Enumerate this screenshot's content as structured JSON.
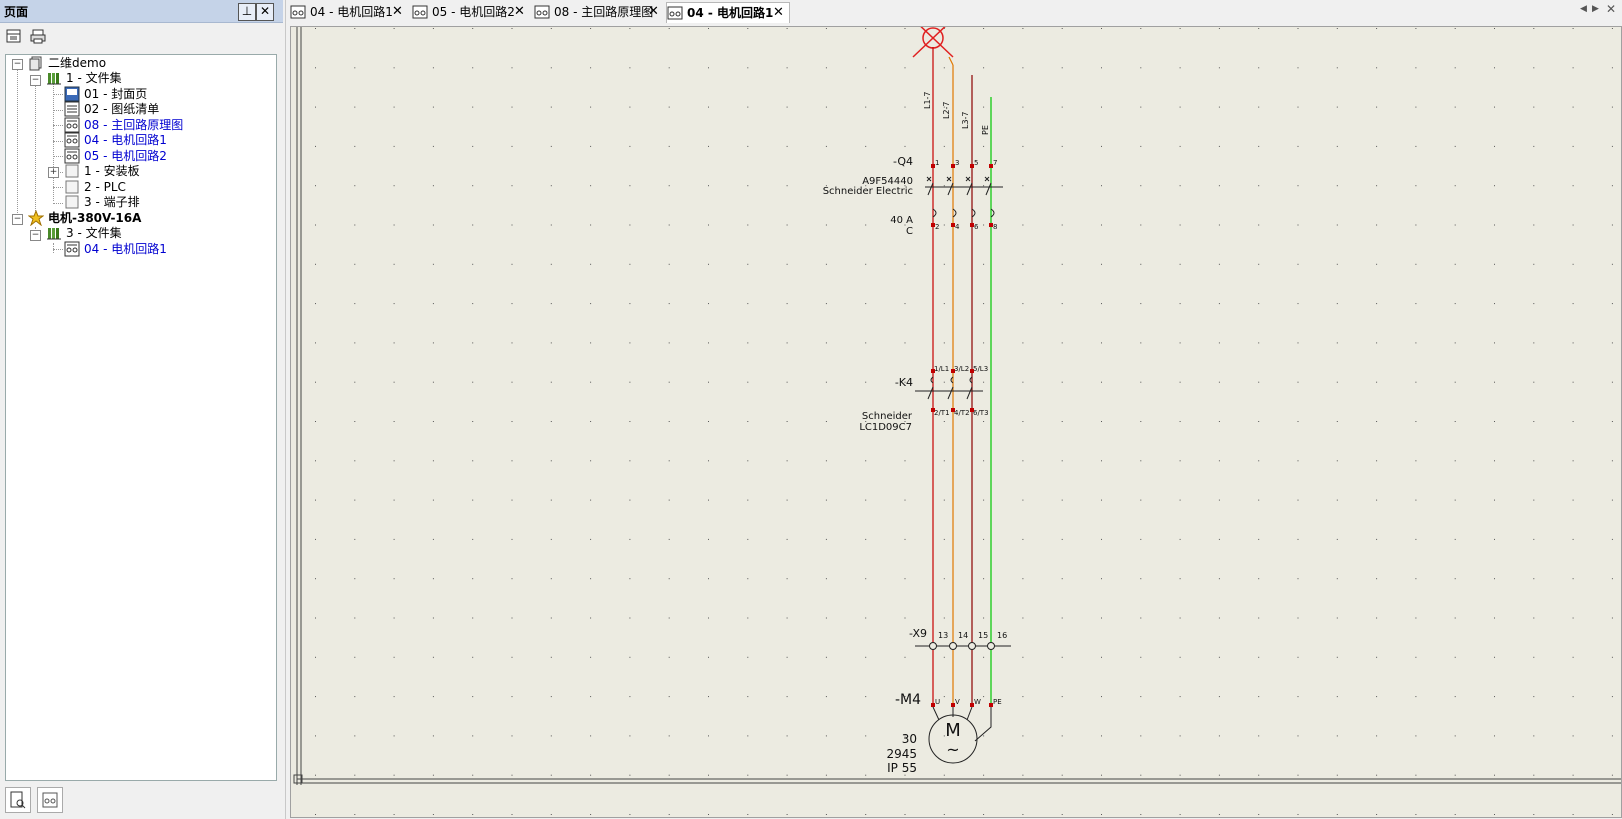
{
  "pane": {
    "title": "页面",
    "pin_glyph": "⊥",
    "close_glyph": "✕",
    "toolbar_icons": [
      "page-view-icon",
      "printer-icon"
    ]
  },
  "tree": {
    "root": "二维demo",
    "folder1": "1 - 文件集",
    "page01": "01 - 封面页",
    "page02": "02 - 图纸清单",
    "page08": "08 - 主回路原理图",
    "page04": "04 - 电机回路1",
    "page05": "05 - 电机回路2",
    "install": "1 - 安装板",
    "plc": "2 - PLC",
    "terminal": "3 - 端子排",
    "motor_root": "电机-380V-16A",
    "folder3": "3 - 文件集",
    "motor_page04": "04 - 电机回路1",
    "expand_minus": "−",
    "expand_plus": "+"
  },
  "tabs": [
    {
      "label": "04 - 电机回路1",
      "close": "✕",
      "active": false
    },
    {
      "label": "05 - 电机回路2",
      "close": "✕",
      "active": false
    },
    {
      "label": "08 - 主回路原理图",
      "close": "✕",
      "active": false
    },
    {
      "label": "04 - 电机回路1",
      "close": "✕",
      "active": true
    }
  ],
  "tab_nav": {
    "left": "◀",
    "right": "▶",
    "close": "✕"
  },
  "schematic": {
    "wire_labels": [
      "L1-7",
      "L2-7",
      "L3-7",
      "PE"
    ],
    "q4": {
      "tag": "-Q4",
      "part": "A9F54440",
      "maker": "Schneider Electric",
      "rating": "40 A",
      "curve": "C",
      "top_pins": [
        "1",
        "3",
        "5",
        "7"
      ],
      "bottom_pins": [
        "2",
        "4",
        "6",
        "8"
      ]
    },
    "k4": {
      "tag": "-K4",
      "maker": "Schneider",
      "part": "LC1D09C7",
      "top_pins": [
        "1/L1",
        "3/L2",
        "5/L3"
      ],
      "bottom_pins": [
        "2/T1",
        "4/T2",
        "6/T3"
      ]
    },
    "x9": {
      "tag": "-X9",
      "pins": [
        "13",
        "14",
        "15",
        "16"
      ]
    },
    "m4": {
      "tag": "-M4",
      "symbol": "M",
      "tilde": "~",
      "pins": [
        "U",
        "V",
        "W",
        "PE"
      ],
      "power": "30",
      "speed": "2945",
      "ip": "IP 55"
    },
    "colors": {
      "L1": "#c80000",
      "L2": "#e07800",
      "L3": "#8b0000",
      "PE": "#00c800"
    }
  }
}
